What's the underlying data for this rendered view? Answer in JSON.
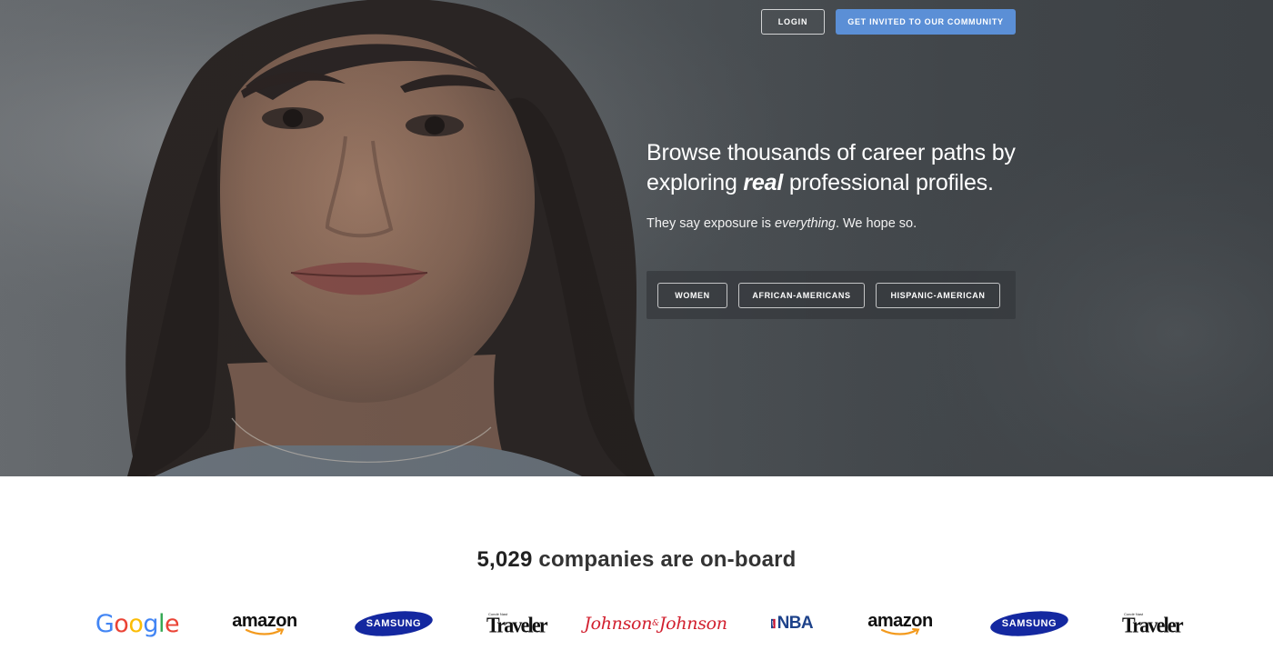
{
  "nav": {
    "login_label": "LOGIN",
    "invite_label": "GET INVITED TO OUR COMMUNITY"
  },
  "hero": {
    "headline_part1": "Browse thousands of career paths by exploring ",
    "headline_emphasis": "real",
    "headline_part2": " professional profiles.",
    "subline_part1": "They say exposure is ",
    "subline_emphasis": "everything",
    "subline_part2": ". We hope so.",
    "filters": [
      "WOMEN",
      "AFRICAN-AMERICANS",
      "HISPANIC-AMERICAN"
    ]
  },
  "companies": {
    "count": "5,029",
    "count_suffix": " companies are on-board",
    "logos": [
      {
        "name": "Google",
        "icon": "google-logo"
      },
      {
        "name": "amazon",
        "icon": "amazon-logo"
      },
      {
        "name": "SAMSUNG",
        "icon": "samsung-logo"
      },
      {
        "name": "Traveler",
        "icon": "conde-nast-traveler-logo",
        "subtext": "Condé Nast"
      },
      {
        "name": "Johnson & Johnson",
        "icon": "johnson-johnson-logo"
      },
      {
        "name": "NBA",
        "icon": "nba-logo"
      },
      {
        "name": "amazon",
        "icon": "amazon-logo"
      },
      {
        "name": "SAMSUNG",
        "icon": "samsung-logo"
      },
      {
        "name": "Traveler",
        "icon": "conde-nast-traveler-logo",
        "subtext": "Condé Nast"
      }
    ]
  },
  "colors": {
    "accent_button": "#5b8fd6",
    "hero_overlay": "#4a4f53",
    "samsung_blue": "#1428a0",
    "jj_red": "#d2202f",
    "nba_blue": "#1d428a"
  }
}
